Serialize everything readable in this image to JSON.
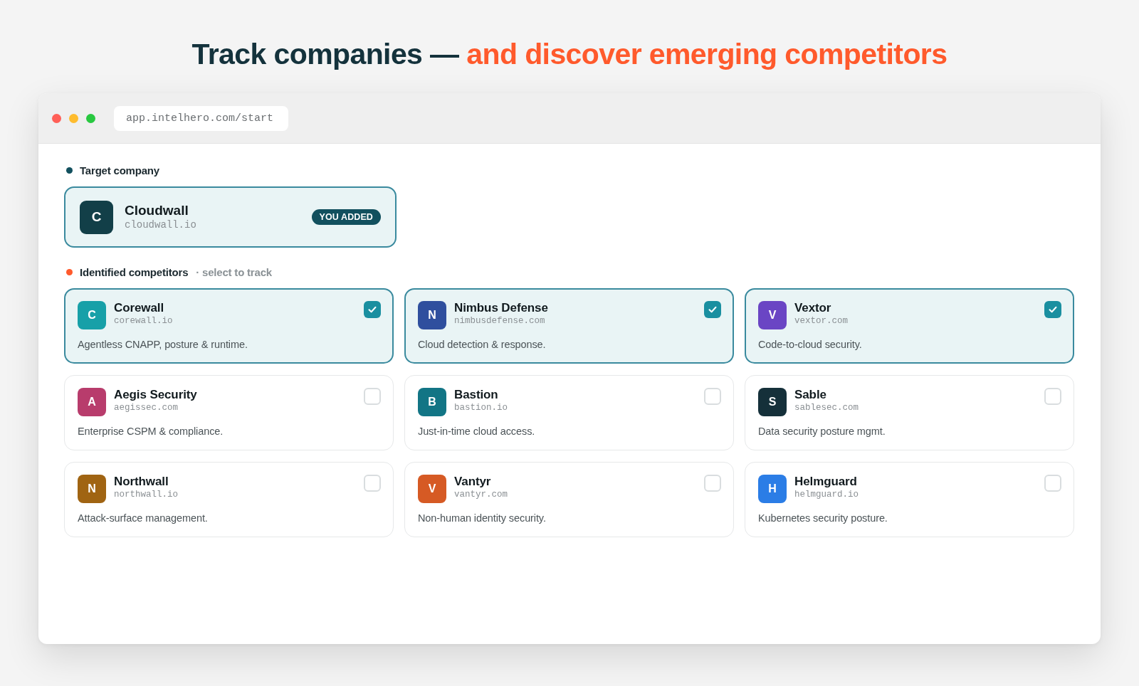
{
  "headline": {
    "lead": "Track companies —",
    "accent": "and discover emerging competitors"
  },
  "browser": {
    "address": "app.intelhero.com/start"
  },
  "target": {
    "label": "Target company",
    "company": {
      "initial": "C",
      "name": "Cloudwall",
      "domain": "cloudwall.io",
      "badge": "YOU ADDED"
    }
  },
  "competitors": {
    "label": "Identified competitors",
    "hint": "· select to track",
    "items": [
      {
        "initial": "C",
        "name": "Corewall",
        "domain": "corewall.io",
        "description": "Agentless CNAPP, posture & runtime.",
        "color": "#17a0a8",
        "selected": true
      },
      {
        "initial": "N",
        "name": "Nimbus Defense",
        "domain": "nimbusdefense.com",
        "description": "Cloud detection & response.",
        "color": "#2f4f9e",
        "selected": true
      },
      {
        "initial": "V",
        "name": "Vextor",
        "domain": "vextor.com",
        "description": "Code-to-cloud security.",
        "color": "#6a45c4",
        "selected": true
      },
      {
        "initial": "A",
        "name": "Aegis Security",
        "domain": "aegissec.com",
        "description": "Enterprise CSPM & compliance.",
        "color": "#b83c6c",
        "selected": false
      },
      {
        "initial": "B",
        "name": "Bastion",
        "domain": "bastion.io",
        "description": "Just-in-time cloud access.",
        "color": "#127585",
        "selected": false
      },
      {
        "initial": "S",
        "name": "Sable",
        "domain": "sablesec.com",
        "description": "Data security posture mgmt.",
        "color": "#15303a",
        "selected": false
      },
      {
        "initial": "N",
        "name": "Northwall",
        "domain": "northwall.io",
        "description": "Attack-surface management.",
        "color": "#a06412",
        "selected": false
      },
      {
        "initial": "V",
        "name": "Vantyr",
        "domain": "vantyr.com",
        "description": "Non-human identity security.",
        "color": "#d65a24",
        "selected": false
      },
      {
        "initial": "H",
        "name": "Helmguard",
        "domain": "helmguard.io",
        "description": "Kubernetes security posture.",
        "color": "#2b7de6",
        "selected": false
      }
    ]
  }
}
